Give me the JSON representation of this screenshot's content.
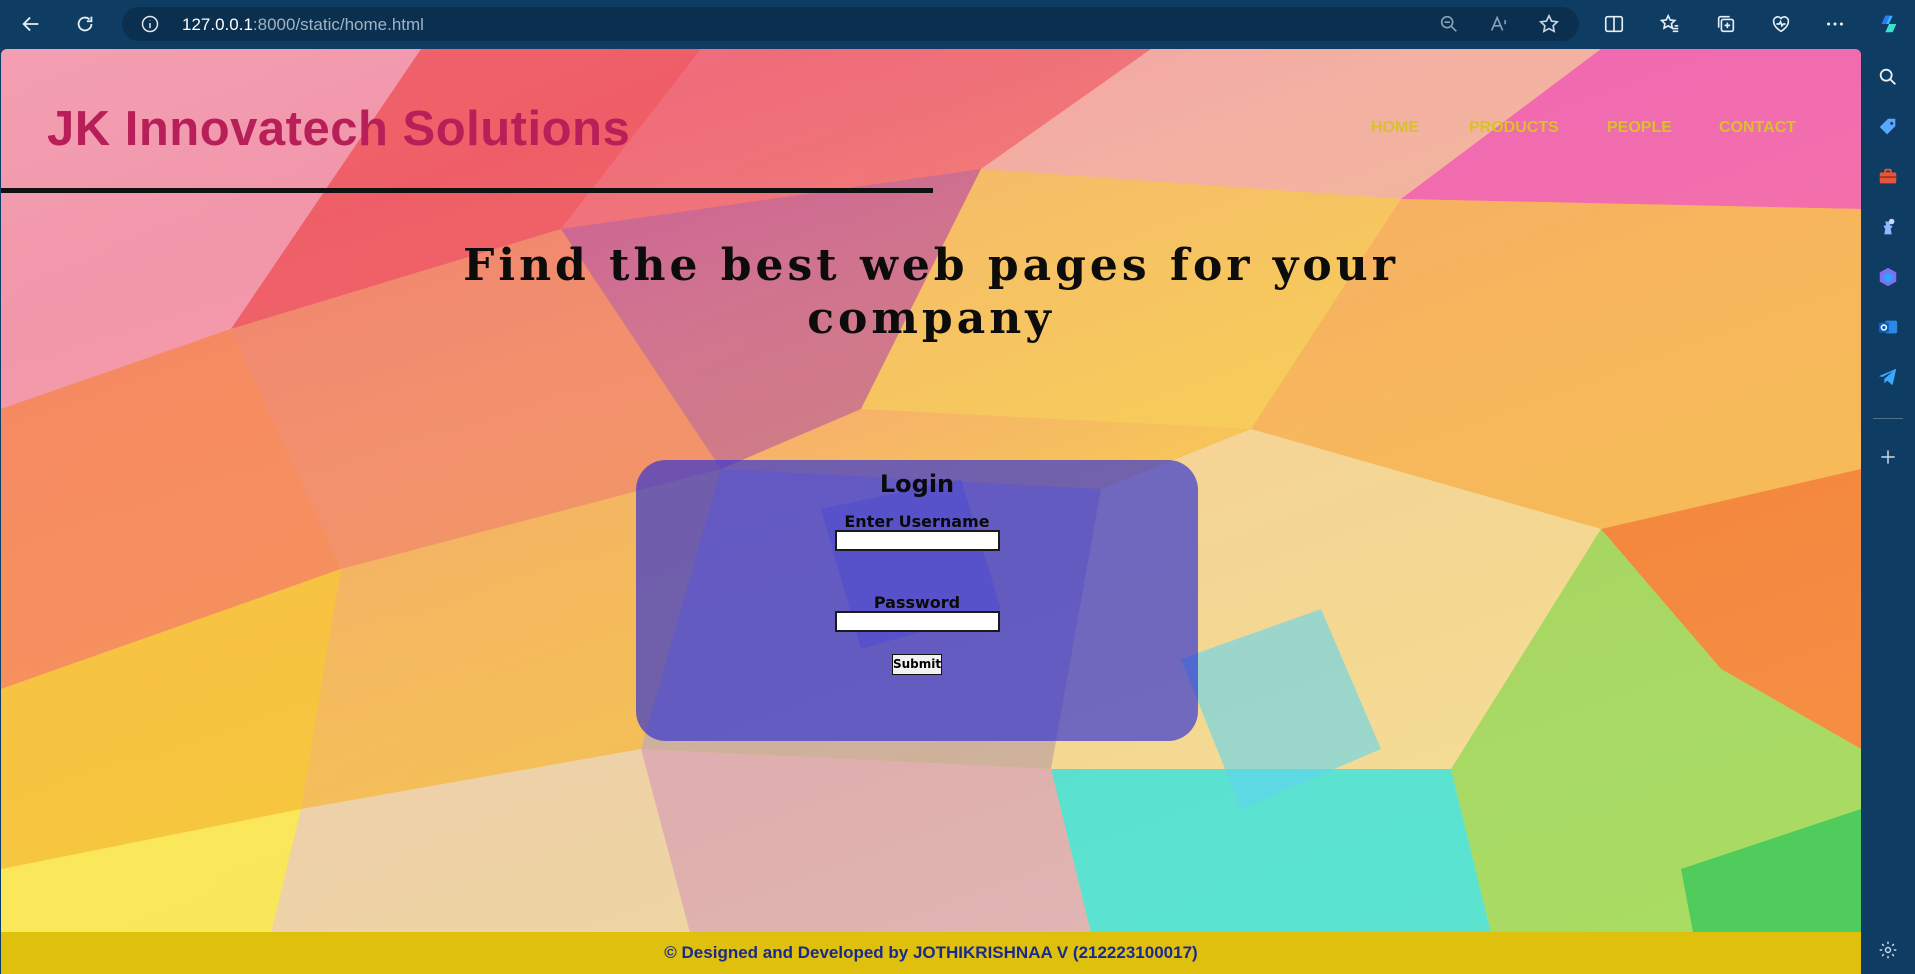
{
  "browser": {
    "url_host": "127.0.0.1",
    "url_rest": ":8000/static/home.html"
  },
  "page": {
    "brand": "JK Innovatech Solutions",
    "nav": [
      "HOME",
      "PRODUCTS",
      "PEOPLE",
      "CONTACT"
    ],
    "headline": "Find the best web pages for your company",
    "login": {
      "title": "Login",
      "username_label": "Enter Username",
      "username_value": "",
      "password_label": "Password",
      "password_value": "",
      "submit_label": "Submit"
    },
    "footer": "© Designed and Developed by JOTHIKRISHNAA V (212223100017)"
  },
  "colors": {
    "brand": "#b81f58",
    "nav": "#d8c12a",
    "footer_bg": "#dfc10d",
    "footer_text": "#1a2a8c",
    "login_panel": "#3034d2"
  }
}
